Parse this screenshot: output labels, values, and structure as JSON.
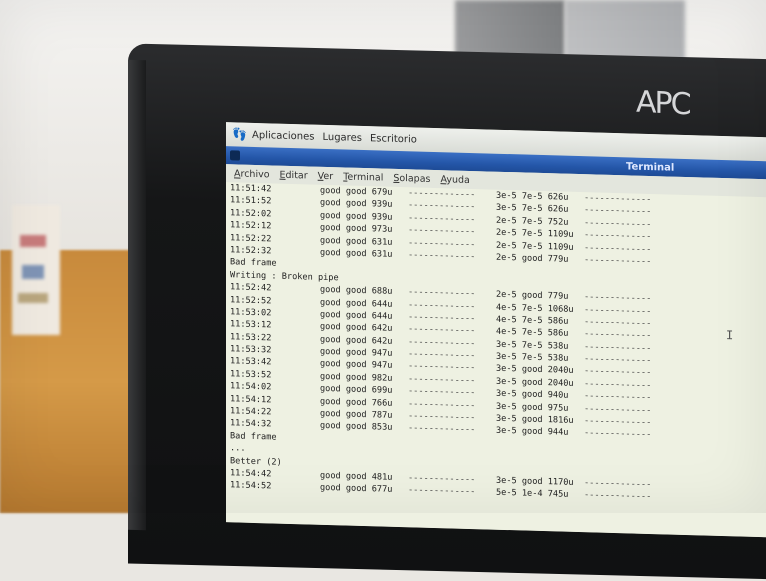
{
  "brand": "APC",
  "panel_menu": [
    "Aplicaciones",
    "Lugares",
    "Escritorio"
  ],
  "window": {
    "title": "Terminal"
  },
  "terminal_menu": [
    "Archivo",
    "Editar",
    "Ver",
    "Terminal",
    "Solapas",
    "Ayuda"
  ],
  "lines": [
    {
      "type": "row",
      "time": "11:51:42",
      "status": "good good 679u",
      "dash1": "-------------",
      "val": "3e-5 7e-5 626u",
      "dash2": "-------------"
    },
    {
      "type": "row",
      "time": "11:51:52",
      "status": "good good 939u",
      "dash1": "-------------",
      "val": "3e-5 7e-5 626u",
      "dash2": "-------------"
    },
    {
      "type": "row",
      "time": "11:52:02",
      "status": "good good 939u",
      "dash1": "-------------",
      "val": "2e-5 7e-5 752u",
      "dash2": "-------------"
    },
    {
      "type": "row",
      "time": "11:52:12",
      "status": "good good 973u",
      "dash1": "-------------",
      "val": "2e-5 7e-5 1109u",
      "dash2": "-------------"
    },
    {
      "type": "row",
      "time": "11:52:22",
      "status": "good good 631u",
      "dash1": "-------------",
      "val": "2e-5 7e-5 1109u",
      "dash2": "-------------"
    },
    {
      "type": "row",
      "time": "11:52:32",
      "status": "good good 631u",
      "dash1": "-------------",
      "val": "2e-5 good 779u",
      "dash2": "-------------"
    },
    {
      "type": "msg",
      "text": "Bad frame"
    },
    {
      "type": "msg",
      "text": "Writing : Broken pipe"
    },
    {
      "type": "row",
      "time": "11:52:42",
      "status": "good good 688u",
      "dash1": "-------------",
      "val": "2e-5 good 779u",
      "dash2": "-------------"
    },
    {
      "type": "row",
      "time": "11:52:52",
      "status": "good good 644u",
      "dash1": "-------------",
      "val": "4e-5 7e-5 1068u",
      "dash2": "-------------"
    },
    {
      "type": "row",
      "time": "11:53:02",
      "status": "good good 644u",
      "dash1": "-------------",
      "val": "4e-5 7e-5 586u",
      "dash2": "-------------"
    },
    {
      "type": "row",
      "time": "11:53:12",
      "status": "good good 642u",
      "dash1": "-------------",
      "val": "4e-5 7e-5 586u",
      "dash2": "-------------"
    },
    {
      "type": "row",
      "time": "11:53:22",
      "status": "good good 642u",
      "dash1": "-------------",
      "val": "3e-5 7e-5 538u",
      "dash2": "-------------"
    },
    {
      "type": "row",
      "time": "11:53:32",
      "status": "good good 947u",
      "dash1": "-------------",
      "val": "3e-5 7e-5 538u",
      "dash2": "-------------"
    },
    {
      "type": "row",
      "time": "11:53:42",
      "status": "good good 947u",
      "dash1": "-------------",
      "val": "3e-5 good 2040u",
      "dash2": "-------------"
    },
    {
      "type": "row",
      "time": "11:53:52",
      "status": "good good 982u",
      "dash1": "-------------",
      "val": "3e-5 good 2040u",
      "dash2": "-------------"
    },
    {
      "type": "row",
      "time": "11:54:02",
      "status": "good good 699u",
      "dash1": "-------------",
      "val": "3e-5 good 940u",
      "dash2": "-------------"
    },
    {
      "type": "row",
      "time": "11:54:12",
      "status": "good good 766u",
      "dash1": "-------------",
      "val": "3e-5 good 975u",
      "dash2": "-------------"
    },
    {
      "type": "row",
      "time": "11:54:22",
      "status": "good good 787u",
      "dash1": "-------------",
      "val": "3e-5 good 1816u",
      "dash2": "-------------"
    },
    {
      "type": "row",
      "time": "11:54:32",
      "status": "good good 853u",
      "dash1": "-------------",
      "val": "3e-5 good 944u",
      "dash2": "-------------"
    },
    {
      "type": "msg",
      "text": "Bad frame"
    },
    {
      "type": "msg",
      "text": "..."
    },
    {
      "type": "msg",
      "text": "Better (2)"
    },
    {
      "type": "row",
      "time": "11:54:42",
      "status": "good good 481u",
      "dash1": "-------------",
      "val": "3e-5 good 1170u",
      "dash2": "-------------"
    },
    {
      "type": "row",
      "time": "11:54:52",
      "status": "good good 677u",
      "dash1": "-------------",
      "val": "5e-5 1e-4 745u",
      "dash2": "-------------"
    }
  ]
}
